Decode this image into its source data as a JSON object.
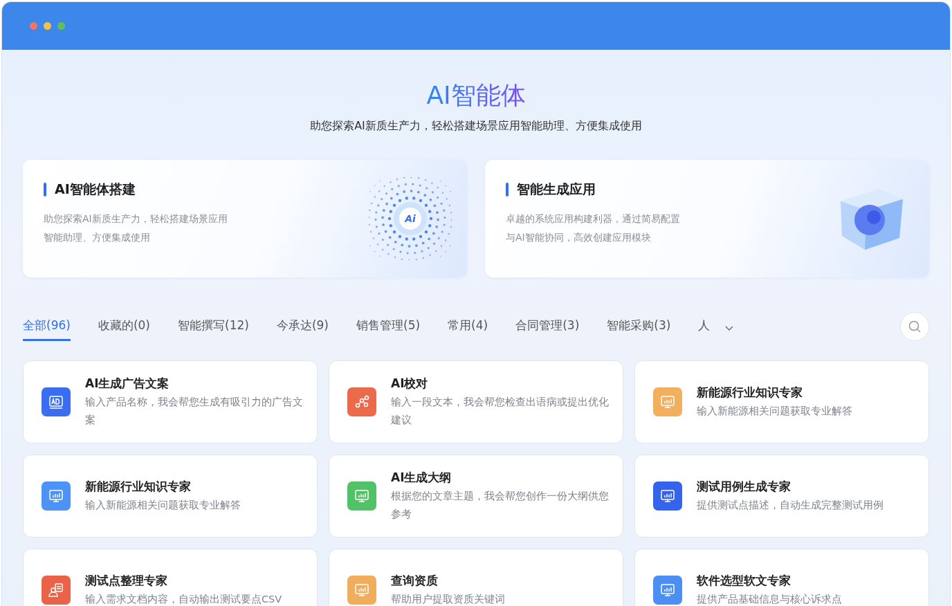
{
  "header": {
    "title": "AI智能体",
    "subtitle": "助您探索AI新质生产力，轻松搭建场景应用智能助理、方便集成使用"
  },
  "banners": [
    {
      "kind": "orb",
      "title": "AI智能体搭建",
      "lines": [
        "助您探索AI新质生产力，轻松搭建场景应用",
        "智能助理、方便集成使用"
      ],
      "logo_text": "Ai"
    },
    {
      "kind": "cube",
      "title": "智能生成应用",
      "lines": [
        "卓越的系统应用构建利器，通过简易配置",
        "与AI智能协同，高效创建应用模块"
      ]
    }
  ],
  "tabs": [
    {
      "label": "全部(96)",
      "selected": true
    },
    {
      "label": "收藏的(0)",
      "selected": false
    },
    {
      "label": "智能撰写(12)",
      "selected": false
    },
    {
      "label": "今承达(9)",
      "selected": false
    },
    {
      "label": "销售管理(5)",
      "selected": false
    },
    {
      "label": "常用(4)",
      "selected": false
    },
    {
      "label": "合同管理(3)",
      "selected": false
    },
    {
      "label": "智能采购(3)",
      "selected": false
    },
    {
      "label": "人",
      "selected": false
    }
  ],
  "agents": [
    {
      "kind": "ad",
      "color": "#3a6df0",
      "title": "AI生成广告文案",
      "description": "输入产品名称，我会帮您生成有吸引力的广告文案"
    },
    {
      "kind": "nodes",
      "color": "#ec6a4c",
      "title": "AI校对",
      "description": "输入一段文本，我会帮您检查出语病或提出优化建议"
    },
    {
      "kind": "monitor",
      "color": "#f2b05e",
      "title": "新能源行业知识专家",
      "description": "输入新能源相关问题获取专业解答"
    },
    {
      "kind": "monitor",
      "color": "#4d92f5",
      "title": "新能源行业知识专家",
      "description": "输入新能源相关问题获取专业解答"
    },
    {
      "kind": "monitor",
      "color": "#52c267",
      "title": "AI生成大纲",
      "description": "根据您的文章主题，我会帮您创作一份大纲供您参考"
    },
    {
      "kind": "monitor",
      "color": "#3463ec",
      "title": "测试用例生成专家",
      "description": "提供测试点描述，自动生成完整测试用例"
    },
    {
      "kind": "person-doc",
      "color": "#ea6248",
      "title": "测试点整理专家",
      "description": "输入需求文档内容，自动输出测试要点CSV"
    },
    {
      "kind": "monitor",
      "color": "#f0ad5c",
      "title": "查询资质",
      "description": "帮助用户提取资质关键词"
    },
    {
      "kind": "monitor",
      "color": "#4b8ff4",
      "title": "软件选型软文专家",
      "description": "提供产品基础信息与核心诉求点"
    }
  ]
}
